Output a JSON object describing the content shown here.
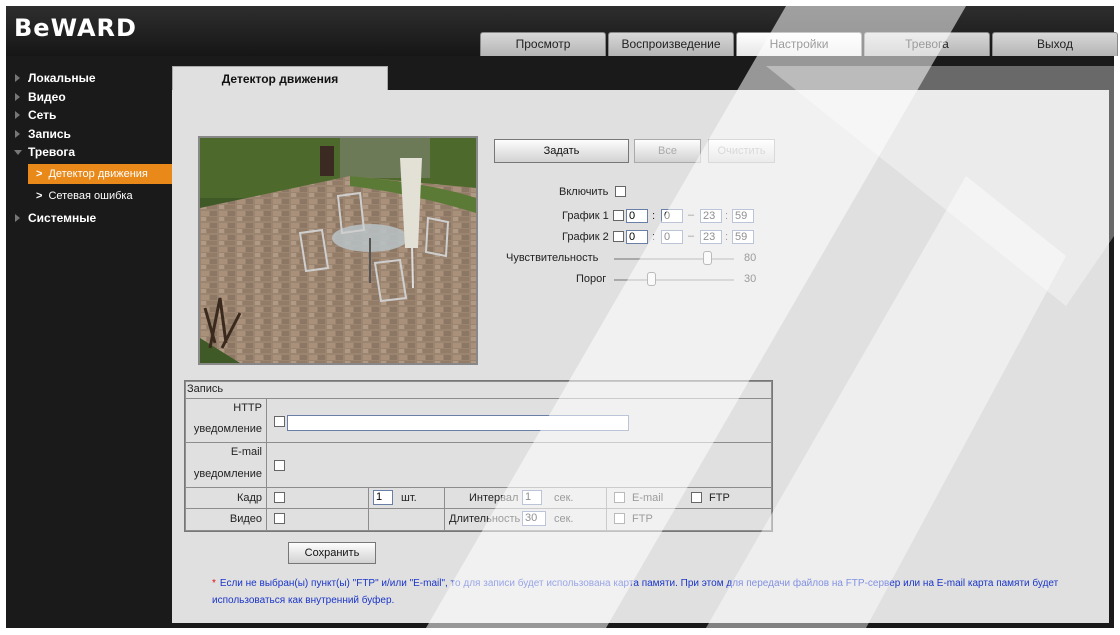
{
  "brand": {
    "logo": "BeWARD"
  },
  "top_tabs": [
    "Просмотр",
    "Воспроизведение",
    "Настройки",
    "Тревога",
    "Выход"
  ],
  "top_tabs_active": "Настройки",
  "sidebar": {
    "items": [
      {
        "label": "Локальные"
      },
      {
        "label": "Видео"
      },
      {
        "label": "Сеть"
      },
      {
        "label": "Запись"
      },
      {
        "label": "Тревога"
      },
      {
        "label": "Системные"
      }
    ],
    "alarm_subitems": [
      {
        "label": "Детектор движения",
        "active": true
      },
      {
        "label": "Сетевая ошибка",
        "active": false
      }
    ]
  },
  "page": {
    "tab_title": "Детектор движения"
  },
  "motion": {
    "buttons": {
      "set": "Задать",
      "all": "Все",
      "clear": "Очистить"
    },
    "enable_label": "Включить",
    "schedule1": {
      "label": "График 1",
      "start_h": "0",
      "start_m": "0",
      "end_h": "23",
      "end_m": "59"
    },
    "schedule2": {
      "label": "График 2",
      "start_h": "0",
      "start_m": "0",
      "end_h": "23",
      "end_m": "59"
    },
    "sensitivity": {
      "label": "Чувствительность",
      "value": "80",
      "fraction": 0.8
    },
    "threshold": {
      "label": "Порог",
      "value": "30",
      "fraction": 0.3
    }
  },
  "record": {
    "header": "Запись",
    "http_label_1": "HTTP",
    "http_label_2": "уведомление",
    "email_label_1": "E-mail",
    "email_label_2": "уведомление",
    "frame_label": "Кадр",
    "frame_count": "1",
    "frame_unit": "шт.",
    "interval_label": "Интервал",
    "interval_value": "1",
    "interval_unit": "сек.",
    "email_opt": "E-mail",
    "ftp_opt": "FTP",
    "video_label": "Видео",
    "duration_label": "Длительность",
    "duration_value": "30",
    "duration_unit": "сек.",
    "video_ftp_opt": "FTP"
  },
  "save_button": "Сохранить",
  "note": {
    "star": "*",
    "text": "Если не выбран(ы) пункт(ы) \"FTP\" и/или \"E-mail\", то для записи будет использована карта памяти. При этом для передачи файлов на FTP-сервер или на E-mail карта памяти будет использоваться как внутренний буфер."
  }
}
